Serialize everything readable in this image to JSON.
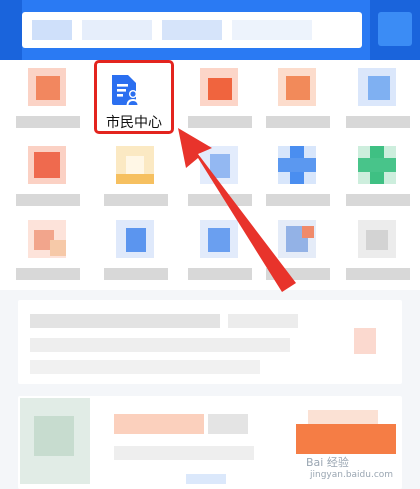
{
  "grid": {
    "highlighted_item": {
      "label": "市民中心",
      "icon": "document-user-icon"
    }
  },
  "colors": {
    "header_blue": "#2a7af3",
    "highlight_red": "#e3241e",
    "arrow_red": "#e8332b",
    "icon_blue": "#2b6ff0"
  },
  "watermark": {
    "text": "Bai 经验",
    "sub": "jingyan.baidu.com"
  }
}
